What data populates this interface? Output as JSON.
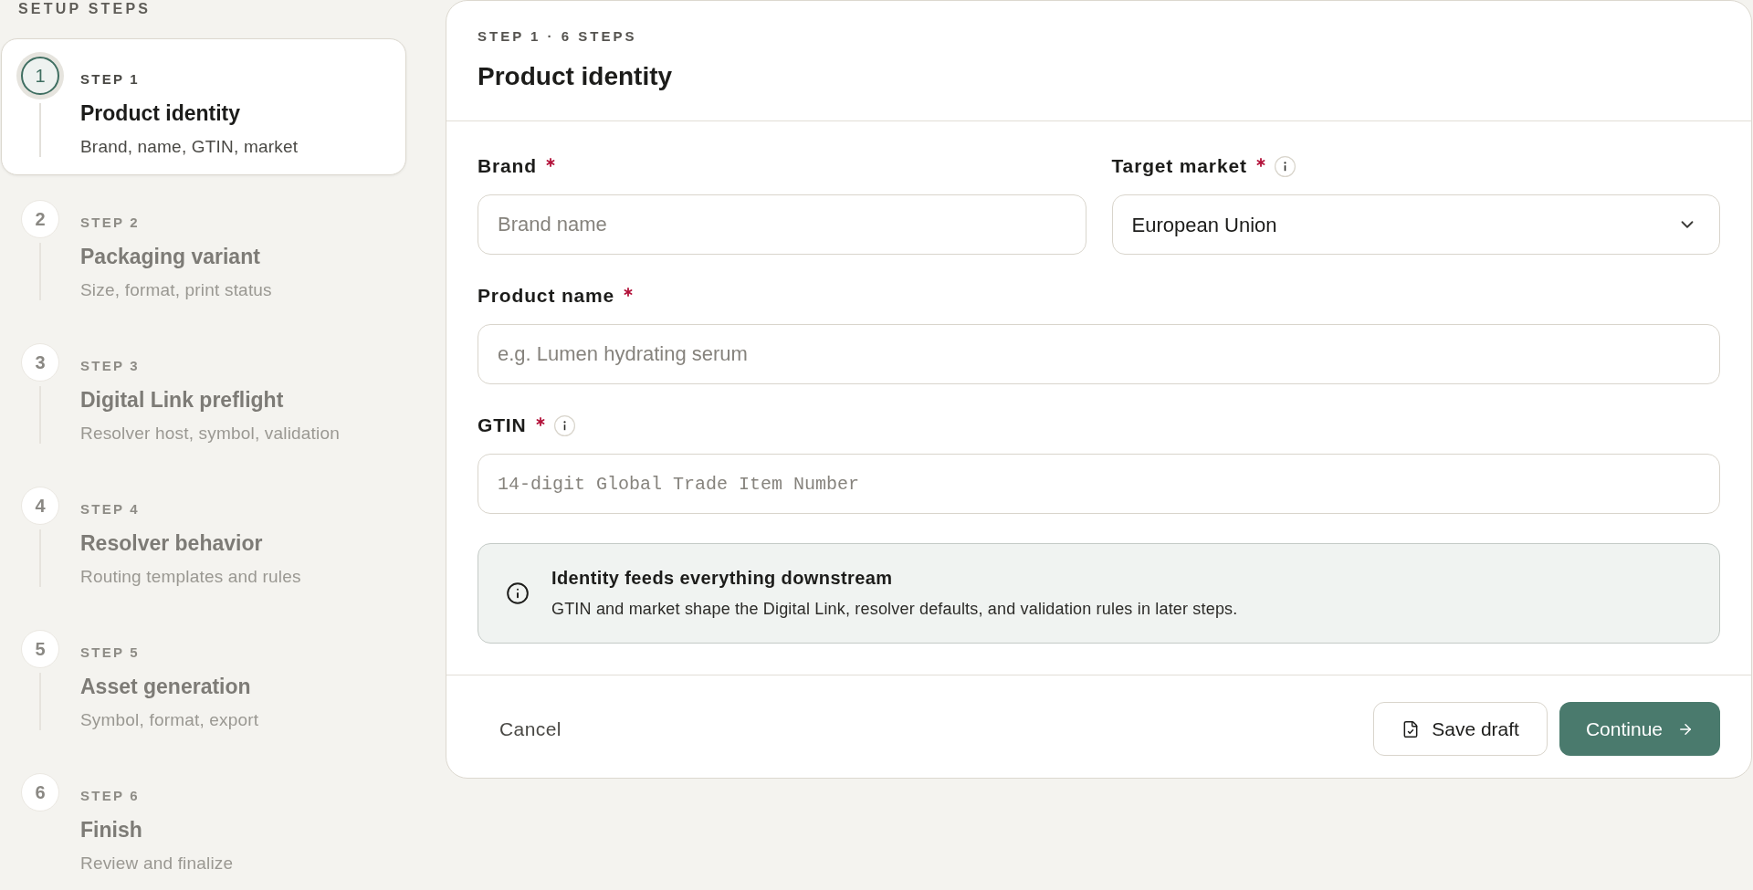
{
  "sidebar": {
    "heading": "SETUP STEPS",
    "steps": [
      {
        "number": "1",
        "label": "STEP 1",
        "title": "Product identity",
        "subtitle": "Brand, name, GTIN, market",
        "selected": true
      },
      {
        "number": "2",
        "label": "STEP 2",
        "title": "Packaging variant",
        "subtitle": "Size, format, print status",
        "selected": false
      },
      {
        "number": "3",
        "label": "STEP 3",
        "title": "Digital Link preflight",
        "subtitle": "Resolver host, symbol, validation",
        "selected": false
      },
      {
        "number": "4",
        "label": "STEP 4",
        "title": "Resolver behavior",
        "subtitle": "Routing templates and rules",
        "selected": false
      },
      {
        "number": "5",
        "label": "STEP 5",
        "title": "Asset generation",
        "subtitle": "Symbol, format, export",
        "selected": false
      },
      {
        "number": "6",
        "label": "STEP 6",
        "title": "Finish",
        "subtitle": "Review and finalize",
        "selected": false
      }
    ]
  },
  "header": {
    "eyebrow": "STEP 1 · 6 STEPS",
    "title": "Product identity"
  },
  "form": {
    "rows": [
      {
        "fields": [
          {
            "kind": "text",
            "label": "Brand",
            "required": true,
            "info": false,
            "placeholder": "Brand name"
          },
          {
            "kind": "select",
            "label": "Target market",
            "required": true,
            "info": true,
            "value": "European Union"
          }
        ]
      },
      {
        "fields": [
          {
            "kind": "text",
            "label": "Product name",
            "required": true,
            "info": false,
            "placeholder": "e.g. Lumen hydrating serum"
          }
        ]
      },
      {
        "fields": [
          {
            "kind": "code",
            "label": "GTIN",
            "required": true,
            "info": true,
            "placeholder": "14-digit Global Trade Item Number"
          }
        ]
      }
    ]
  },
  "notice": {
    "title": "Identity feeds everything downstream",
    "text": "GTIN and market shape the Digital Link, resolver defaults, and validation rules in later steps."
  },
  "footer": {
    "buttons": [
      {
        "kind": "ghost",
        "label": "Cancel"
      },
      {
        "kind": "secondary",
        "label": "Save draft"
      },
      {
        "kind": "primary",
        "label": "Continue"
      }
    ]
  }
}
